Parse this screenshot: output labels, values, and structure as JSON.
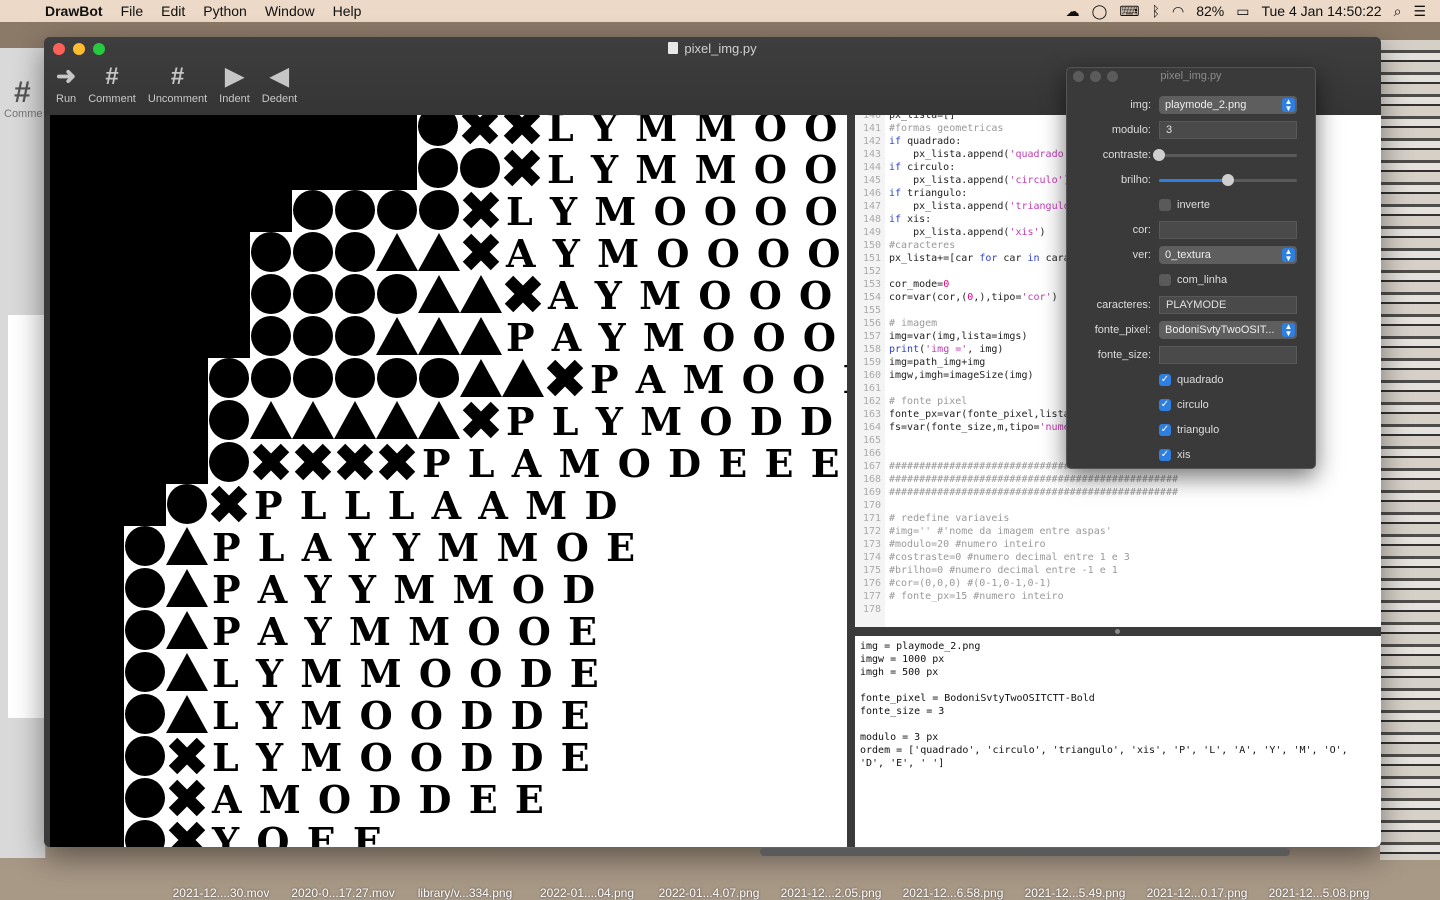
{
  "menubar": {
    "app": "DrawBot",
    "items": [
      "File",
      "Edit",
      "Python",
      "Window",
      "Help"
    ],
    "battery": "82%",
    "clock": "Tue 4 Jan  14:50:22"
  },
  "window": {
    "title": "pixel_img.py",
    "toolbar": [
      {
        "label": "Run",
        "icon": "run-icon",
        "glyph": "➜"
      },
      {
        "label": "Comment",
        "icon": "comment-icon",
        "glyph": "#"
      },
      {
        "label": "Uncomment",
        "icon": "uncomment-icon",
        "glyph": "#"
      },
      {
        "label": "Indent",
        "icon": "indent-icon",
        "glyph": "▶"
      },
      {
        "label": "Dedent",
        "icon": "dedent-icon",
        "glyph": "◀"
      }
    ]
  },
  "back_window": {
    "label": "Comme"
  },
  "canvas": {
    "rows": [
      {
        "shapes": "",
        "text": "L Y M M O O O O"
      },
      {
        "shapes": "",
        "text": "L Y M M O O O O"
      },
      {
        "shapes": "",
        "text": "L Y M O O O O O"
      },
      {
        "shapes": "",
        "text": "A Y M O O O O O"
      },
      {
        "shapes": "",
        "text": "A Y M O O O O N"
      },
      {
        "shapes": "",
        "text": "P A Y M O O O O N"
      },
      {
        "shapes": "",
        "text": "P A M O O D O O O"
      },
      {
        "shapes": "",
        "text": "P L Y M O D D D D"
      },
      {
        "shapes": "",
        "text": "P L A M O D E E E E"
      },
      {
        "shapes": "",
        "text": "P L L L A A M D"
      },
      {
        "shapes": "",
        "text": "P L A Y Y M M O E"
      },
      {
        "shapes": "",
        "text": "P A Y Y M M O D"
      },
      {
        "shapes": "",
        "text": "P A Y M M O O E"
      },
      {
        "shapes": "",
        "text": "L Y M M O O D E"
      },
      {
        "shapes": "",
        "text": "L Y M O O D D E"
      },
      {
        "shapes": "",
        "text": "L Y M O O D D E"
      },
      {
        "shapes": "",
        "text": "A M O D D E E"
      },
      {
        "shapes": "",
        "text": "Y O E E"
      }
    ]
  },
  "editor": {
    "lines": [
      {
        "n": "140",
        "parts": [
          [
            "txt",
            "px_lista=[]"
          ]
        ]
      },
      {
        "n": "141",
        "parts": [
          [
            "com",
            "#formas geometricas"
          ]
        ]
      },
      {
        "n": "142",
        "parts": [
          [
            "kw",
            "if "
          ],
          [
            "txt",
            "quadrado:"
          ]
        ]
      },
      {
        "n": "143",
        "parts": [
          [
            "txt",
            "    px_lista.append("
          ],
          [
            "str",
            "'quadrado'"
          ],
          [
            "txt",
            ")"
          ]
        ]
      },
      {
        "n": "144",
        "parts": [
          [
            "kw",
            "if "
          ],
          [
            "txt",
            "circulo:"
          ]
        ]
      },
      {
        "n": "145",
        "parts": [
          [
            "txt",
            "    px_lista.append("
          ],
          [
            "str",
            "'circulo'"
          ],
          [
            "txt",
            ")"
          ]
        ]
      },
      {
        "n": "146",
        "parts": [
          [
            "kw",
            "if "
          ],
          [
            "txt",
            "triangulo:"
          ]
        ]
      },
      {
        "n": "147",
        "parts": [
          [
            "txt",
            "    px_lista.append("
          ],
          [
            "str",
            "'triangulo'"
          ],
          [
            "txt",
            ")"
          ]
        ]
      },
      {
        "n": "148",
        "parts": [
          [
            "kw",
            "if "
          ],
          [
            "txt",
            "xis:"
          ]
        ]
      },
      {
        "n": "149",
        "parts": [
          [
            "txt",
            "    px_lista.append("
          ],
          [
            "str",
            "'xis'"
          ],
          [
            "txt",
            ")"
          ]
        ]
      },
      {
        "n": "150",
        "parts": [
          [
            "com",
            "#caracteres"
          ]
        ]
      },
      {
        "n": "151",
        "parts": [
          [
            "txt",
            "px_lista+=[car "
          ],
          [
            "kw",
            "for "
          ],
          [
            "txt",
            "car "
          ],
          [
            "kw",
            "in "
          ],
          [
            "txt",
            "caracteres]"
          ]
        ]
      },
      {
        "n": "152",
        "parts": []
      },
      {
        "n": "153",
        "parts": [
          [
            "txt",
            "cor_mode="
          ],
          [
            "num",
            "0"
          ]
        ]
      },
      {
        "n": "154",
        "parts": [
          [
            "txt",
            "cor=var(cor,("
          ],
          [
            "num",
            "0"
          ],
          [
            "txt",
            ",),tipo="
          ],
          [
            "str",
            "'cor'"
          ],
          [
            "txt",
            ")"
          ]
        ]
      },
      {
        "n": "155",
        "parts": []
      },
      {
        "n": "156",
        "parts": [
          [
            "com",
            "# imagem"
          ]
        ]
      },
      {
        "n": "157",
        "parts": [
          [
            "txt",
            "img=var(img,lista=imgs)"
          ]
        ]
      },
      {
        "n": "158",
        "parts": [
          [
            "kw",
            "print"
          ],
          [
            "txt",
            "("
          ],
          [
            "str",
            "'img ='"
          ],
          [
            "txt",
            ", img)"
          ]
        ]
      },
      {
        "n": "159",
        "parts": [
          [
            "txt",
            "img=path_img+img"
          ]
        ]
      },
      {
        "n": "160",
        "parts": [
          [
            "txt",
            "imgw,imgh=imageSize(img)"
          ]
        ]
      },
      {
        "n": "161",
        "parts": []
      },
      {
        "n": "162",
        "parts": [
          [
            "com",
            "# fonte pixel"
          ]
        ]
      },
      {
        "n": "163",
        "parts": [
          [
            "txt",
            "fonte_px=var(fonte_pixel,lista=fontes)"
          ]
        ]
      },
      {
        "n": "164",
        "parts": [
          [
            "txt",
            "fs=var(fonte_size,m,tipo="
          ],
          [
            "str",
            "'numero'"
          ],
          [
            "txt",
            ")"
          ]
        ]
      },
      {
        "n": "165",
        "parts": []
      },
      {
        "n": "166",
        "parts": []
      },
      {
        "n": "167",
        "parts": [
          [
            "com",
            "################################################"
          ]
        ]
      },
      {
        "n": "168",
        "parts": [
          [
            "com",
            "################################################"
          ]
        ]
      },
      {
        "n": "169",
        "parts": [
          [
            "com",
            "################################################"
          ]
        ]
      },
      {
        "n": "170",
        "parts": []
      },
      {
        "n": "171",
        "parts": [
          [
            "com",
            "# redefine variaveis"
          ]
        ]
      },
      {
        "n": "172",
        "parts": [
          [
            "com",
            "#img='' #'nome da imagem entre aspas'"
          ]
        ]
      },
      {
        "n": "173",
        "parts": [
          [
            "com",
            "#modulo=20 #numero inteiro"
          ]
        ]
      },
      {
        "n": "174",
        "parts": [
          [
            "com",
            "#costraste=0 #numero decimal entre 1 e 3"
          ]
        ]
      },
      {
        "n": "175",
        "parts": [
          [
            "com",
            "#brilho=0 #numero decimal entre -1 e 1"
          ]
        ]
      },
      {
        "n": "176",
        "parts": [
          [
            "com",
            "#cor=(0,0,0) #(0-1,0-1,0-1)"
          ]
        ]
      },
      {
        "n": "177",
        "parts": [
          [
            "com",
            "# fonte_px=15 #numero inteiro"
          ]
        ]
      },
      {
        "n": "178",
        "parts": []
      }
    ]
  },
  "console": {
    "lines": [
      "img = playmode_2.png",
      "imgw = 1000 px",
      "imgh = 500 px",
      "",
      "fonte_pixel = BodoniSvtyTwoOSITCTT-Bold",
      "fonte_size = 3",
      "",
      "modulo = 3 px",
      "ordem = ['quadrado', 'circulo', 'triangulo', 'xis', 'P', 'L', 'A', 'Y', 'M', 'O',",
      "'D', 'E', ' ']"
    ]
  },
  "panel": {
    "title": "pixel_img.py",
    "img_label": "img:",
    "img_value": "playmode_2.png",
    "modulo_label": "modulo:",
    "modulo_value": "3",
    "contraste_label": "contraste:",
    "contraste_level": 0.0,
    "brilho_label": "brilho:",
    "brilho_level": 0.5,
    "inverte_label": "inverte",
    "inverte_checked": false,
    "cor_label": "cor:",
    "cor_value": "",
    "ver_label": "ver:",
    "ver_value": "0_textura",
    "com_linha_label": "com_linha",
    "com_linha_checked": false,
    "caracteres_label": "caracteres:",
    "caracteres_value": "PLAYMODE",
    "fonte_pixel_label": "fonte_pixel:",
    "fonte_pixel_value": "BodoniSvtyTwoOSIT...",
    "fonte_size_label": "fonte_size:",
    "fonte_size_value": "",
    "checks": [
      {
        "label": "quadrado",
        "checked": true
      },
      {
        "label": "circulo",
        "checked": true
      },
      {
        "label": "triangulo",
        "checked": true
      },
      {
        "label": "xis",
        "checked": true
      }
    ]
  },
  "desktop_files": [
    "2021-12....30.mov",
    "2020-0...17.27.mov",
    "library/v...334.png",
    "2022-01....04.png",
    "2022-01...4.07.png",
    "2021-12...2.05.png",
    "2021-12...6.58.png",
    "2021-12...5.49.png",
    "2021-12...0.17.png",
    "2021-12...5.08.png"
  ],
  "colors": {
    "accent": "#2f7fe0",
    "window_bg": "#3a3a3a",
    "menubar": "#ecd9c7"
  }
}
